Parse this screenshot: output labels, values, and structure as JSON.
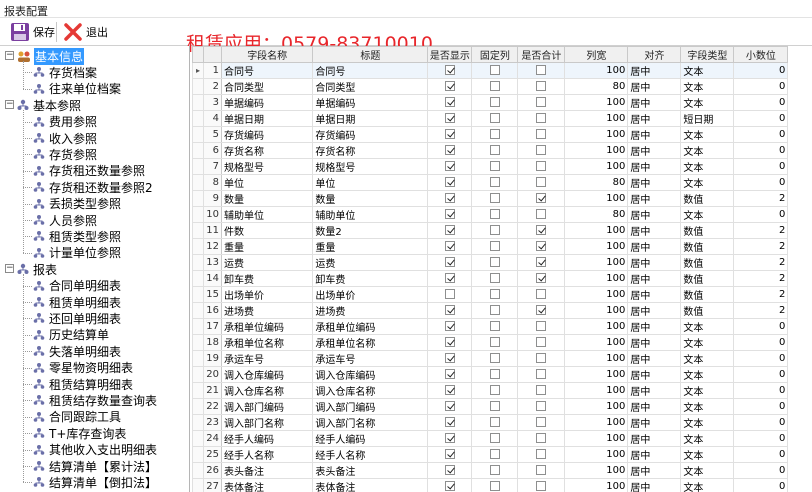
{
  "window": {
    "title": "报表配置"
  },
  "toolbar": {
    "save_label": "保存",
    "exit_label": "退出",
    "banner": "租赁应用：0579-83710010"
  },
  "tree": {
    "groups": [
      {
        "label": "基本信息",
        "items": [
          "存货档案",
          "往来单位档案"
        ]
      },
      {
        "label": "基本参照",
        "items": [
          "费用参照",
          "收入参照",
          "存货参照",
          "存货租还数量参照",
          "存货租还数量参照2",
          "丢损类型参照",
          "人员参照",
          "租赁类型参照",
          "计量单位参照"
        ]
      },
      {
        "label": "报表",
        "items": [
          "合同单明细表",
          "租赁单明细表",
          "还回单明细表",
          "历史结算单",
          "失落单明细表",
          "零星物资明细表",
          "租赁结算明细表",
          "租赁结存数量查询表",
          "合同跟踪工具",
          "T+库存查询表",
          "其他收入支出明细表",
          "结算清单【累计法】",
          "结算清单【倒扣法】"
        ]
      }
    ]
  },
  "grid": {
    "columns": [
      "字段名称",
      "标题",
      "是否显示",
      "固定列",
      "是否合计",
      "列宽",
      "对齐",
      "字段类型",
      "小数位"
    ],
    "rows": [
      [
        "1",
        "合同号",
        "合同号",
        true,
        false,
        false,
        "100",
        "居中",
        "文本",
        "0"
      ],
      [
        "2",
        "合同类型",
        "合同类型",
        true,
        false,
        false,
        "80",
        "居中",
        "文本",
        "0"
      ],
      [
        "3",
        "单据编码",
        "单据编码",
        true,
        false,
        false,
        "100",
        "居中",
        "文本",
        "0"
      ],
      [
        "4",
        "单据日期",
        "单据日期",
        true,
        false,
        false,
        "100",
        "居中",
        "短日期",
        "0"
      ],
      [
        "5",
        "存货编码",
        "存货编码",
        true,
        false,
        false,
        "100",
        "居中",
        "文本",
        "0"
      ],
      [
        "6",
        "存货名称",
        "存货名称",
        true,
        false,
        false,
        "100",
        "居中",
        "文本",
        "0"
      ],
      [
        "7",
        "规格型号",
        "规格型号",
        true,
        false,
        false,
        "100",
        "居中",
        "文本",
        "0"
      ],
      [
        "8",
        "单位",
        "单位",
        true,
        false,
        false,
        "80",
        "居中",
        "文本",
        "0"
      ],
      [
        "9",
        "数量",
        "数量",
        true,
        false,
        true,
        "100",
        "居中",
        "数值",
        "2"
      ],
      [
        "10",
        "辅助单位",
        "辅助单位",
        true,
        false,
        false,
        "80",
        "居中",
        "文本",
        "0"
      ],
      [
        "11",
        "件数",
        "数量2",
        true,
        false,
        true,
        "100",
        "居中",
        "数值",
        "2"
      ],
      [
        "12",
        "重量",
        "重量",
        true,
        false,
        true,
        "100",
        "居中",
        "数值",
        "2"
      ],
      [
        "13",
        "运费",
        "运费",
        true,
        false,
        true,
        "100",
        "居中",
        "数值",
        "2"
      ],
      [
        "14",
        "卸车费",
        "卸车费",
        true,
        false,
        true,
        "100",
        "居中",
        "数值",
        "2"
      ],
      [
        "15",
        "出场单价",
        "出场单价",
        false,
        false,
        false,
        "100",
        "居中",
        "数值",
        "2"
      ],
      [
        "16",
        "进场费",
        "进场费",
        true,
        false,
        true,
        "100",
        "居中",
        "数值",
        "2"
      ],
      [
        "17",
        "承租单位编码",
        "承租单位编码",
        true,
        false,
        false,
        "100",
        "居中",
        "文本",
        "0"
      ],
      [
        "18",
        "承租单位名称",
        "承租单位名称",
        true,
        false,
        false,
        "100",
        "居中",
        "文本",
        "0"
      ],
      [
        "19",
        "承运车号",
        "承运车号",
        true,
        false,
        false,
        "100",
        "居中",
        "文本",
        "0"
      ],
      [
        "20",
        "调入仓库编码",
        "调入仓库编码",
        true,
        false,
        false,
        "100",
        "居中",
        "文本",
        "0"
      ],
      [
        "21",
        "调入仓库名称",
        "调入仓库名称",
        true,
        false,
        false,
        "100",
        "居中",
        "文本",
        "0"
      ],
      [
        "22",
        "调入部门编码",
        "调入部门编码",
        true,
        false,
        false,
        "100",
        "居中",
        "文本",
        "0"
      ],
      [
        "23",
        "调入部门名称",
        "调入部门名称",
        true,
        false,
        false,
        "100",
        "居中",
        "文本",
        "0"
      ],
      [
        "24",
        "经手人编码",
        "经手人编码",
        true,
        false,
        false,
        "100",
        "居中",
        "文本",
        "0"
      ],
      [
        "25",
        "经手人名称",
        "经手人名称",
        true,
        false,
        false,
        "100",
        "居中",
        "文本",
        "0"
      ],
      [
        "26",
        "表头备注",
        "表头备注",
        true,
        false,
        false,
        "100",
        "居中",
        "文本",
        "0"
      ],
      [
        "27",
        "表体备注",
        "表体备注",
        true,
        false,
        false,
        "100",
        "居中",
        "文本",
        "0"
      ],
      [
        "28",
        "表头文本自定义项1",
        "文本自定义项1",
        true,
        false,
        false,
        "100",
        "居中",
        "文本",
        "0"
      ]
    ]
  }
}
